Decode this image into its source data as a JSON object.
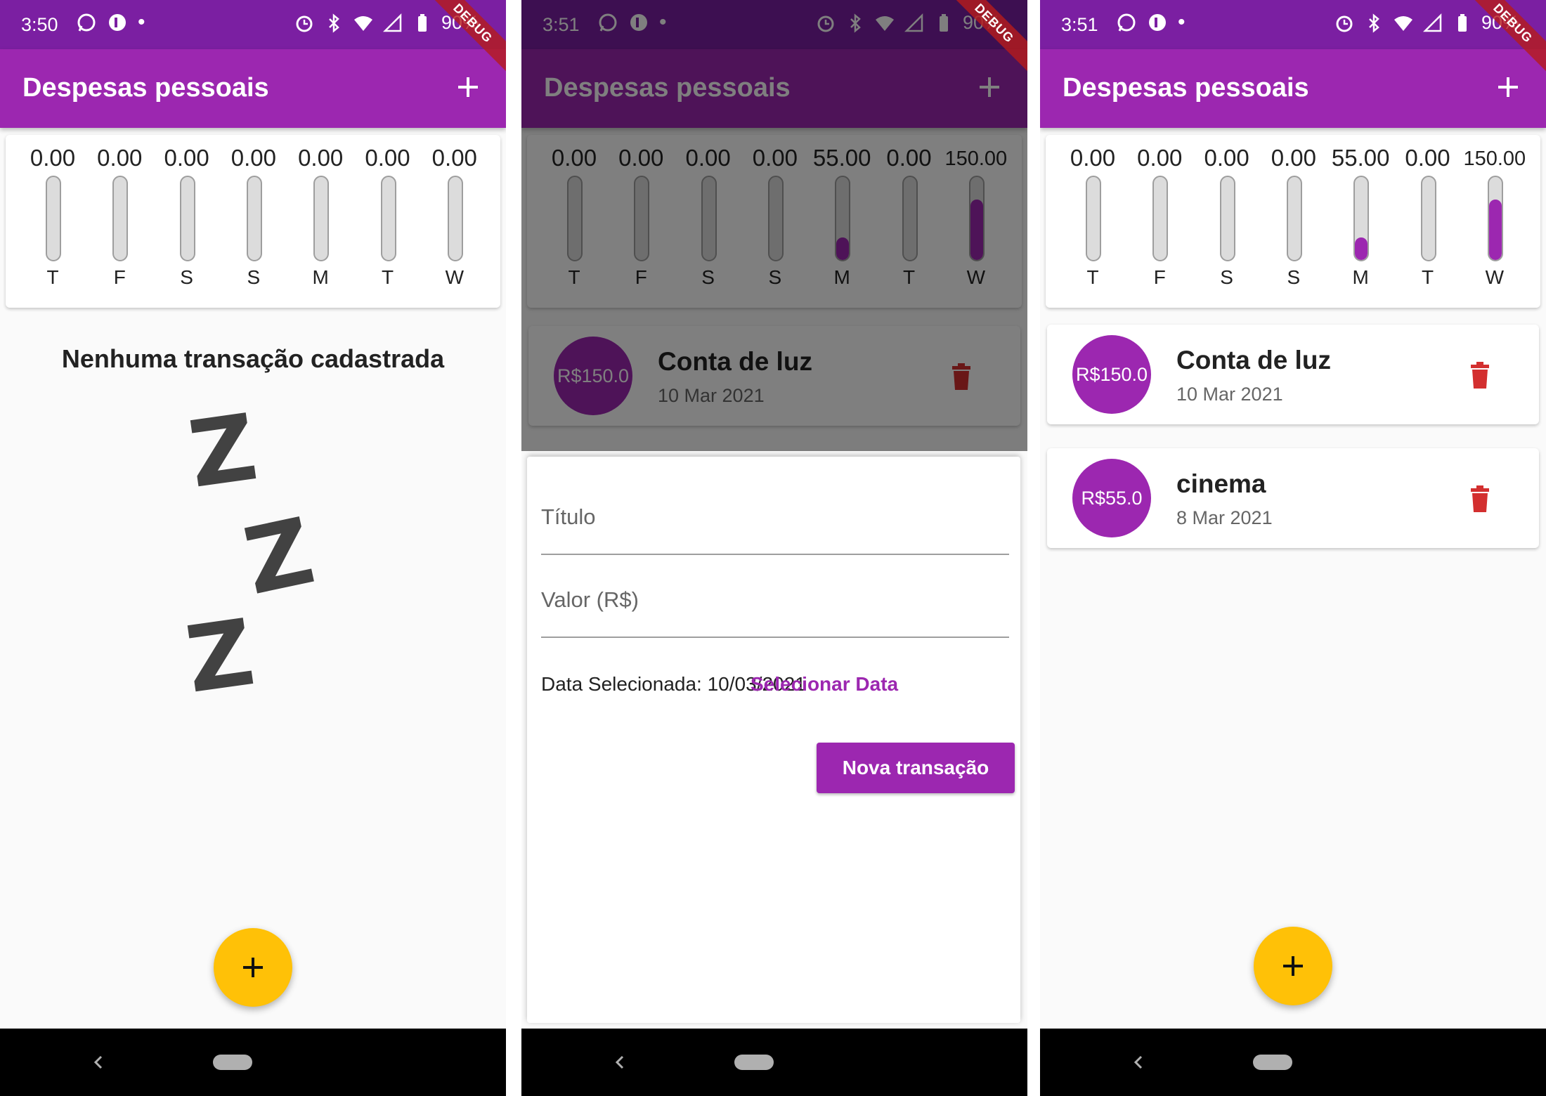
{
  "colors": {
    "primary": "#9c27b0",
    "primary_dark": "#7b1fa2",
    "accent": "#ffc107",
    "danger": "#d32f2f"
  },
  "screens": [
    {
      "status": {
        "time": "3:50",
        "battery": "90%"
      },
      "debug_ribbon": "DEBUG",
      "app_bar": {
        "title": "Despesas pessoais",
        "add_icon": "plus-icon"
      },
      "chart": {
        "bars": [
          {
            "label": "T",
            "value_text": "0.00",
            "fraction": 0
          },
          {
            "label": "F",
            "value_text": "0.00",
            "fraction": 0
          },
          {
            "label": "S",
            "value_text": "0.00",
            "fraction": 0
          },
          {
            "label": "S",
            "value_text": "0.00",
            "fraction": 0
          },
          {
            "label": "M",
            "value_text": "0.00",
            "fraction": 0
          },
          {
            "label": "T",
            "value_text": "0.00",
            "fraction": 0
          },
          {
            "label": "W",
            "value_text": "0.00",
            "fraction": 0
          }
        ]
      },
      "empty_state": {
        "title": "Nenhuma transação cadastrada",
        "illustration": "sleeping-zzz"
      },
      "fab_icon": "plus-icon"
    },
    {
      "status": {
        "time": "3:51",
        "battery": "90%"
      },
      "debug_ribbon": "DEBUG",
      "app_bar": {
        "title": "Despesas pessoais",
        "add_icon": "plus-icon"
      },
      "chart": {
        "bars": [
          {
            "label": "T",
            "value_text": "0.00",
            "fraction": 0
          },
          {
            "label": "F",
            "value_text": "0.00",
            "fraction": 0
          },
          {
            "label": "S",
            "value_text": "0.00",
            "fraction": 0
          },
          {
            "label": "S",
            "value_text": "0.00",
            "fraction": 0
          },
          {
            "label": "M",
            "value_text": "55.00",
            "fraction": 0.2683
          },
          {
            "label": "T",
            "value_text": "0.00",
            "fraction": 0
          },
          {
            "label": "W",
            "value_text": "150.00",
            "fraction": 0.7317
          }
        ]
      },
      "transactions": [
        {
          "amount": "R$150.0",
          "title": "Conta de luz",
          "date": "10 Mar 2021"
        }
      ],
      "form": {
        "title_placeholder": "Título",
        "value_placeholder": "Valor (R$)",
        "selected_date": "Data Selecionada: 10/03/2021",
        "select_date_label": "Selecionar Data",
        "submit_label": "Nova transação"
      }
    },
    {
      "status": {
        "time": "3:51",
        "battery": "90%"
      },
      "debug_ribbon": "DEBUG",
      "app_bar": {
        "title": "Despesas pessoais",
        "add_icon": "plus-icon"
      },
      "chart": {
        "bars": [
          {
            "label": "T",
            "value_text": "0.00",
            "fraction": 0
          },
          {
            "label": "F",
            "value_text": "0.00",
            "fraction": 0
          },
          {
            "label": "S",
            "value_text": "0.00",
            "fraction": 0
          },
          {
            "label": "S",
            "value_text": "0.00",
            "fraction": 0
          },
          {
            "label": "M",
            "value_text": "55.00",
            "fraction": 0.2683
          },
          {
            "label": "T",
            "value_text": "0.00",
            "fraction": 0
          },
          {
            "label": "W",
            "value_text": "150.00",
            "fraction": 0.7317
          }
        ]
      },
      "transactions": [
        {
          "amount": "R$150.0",
          "title": "Conta de luz",
          "date": "10 Mar 2021"
        },
        {
          "amount": "R$55.0",
          "title": "cinema",
          "date": "8 Mar 2021"
        }
      ],
      "fab_icon": "plus-icon"
    }
  ]
}
